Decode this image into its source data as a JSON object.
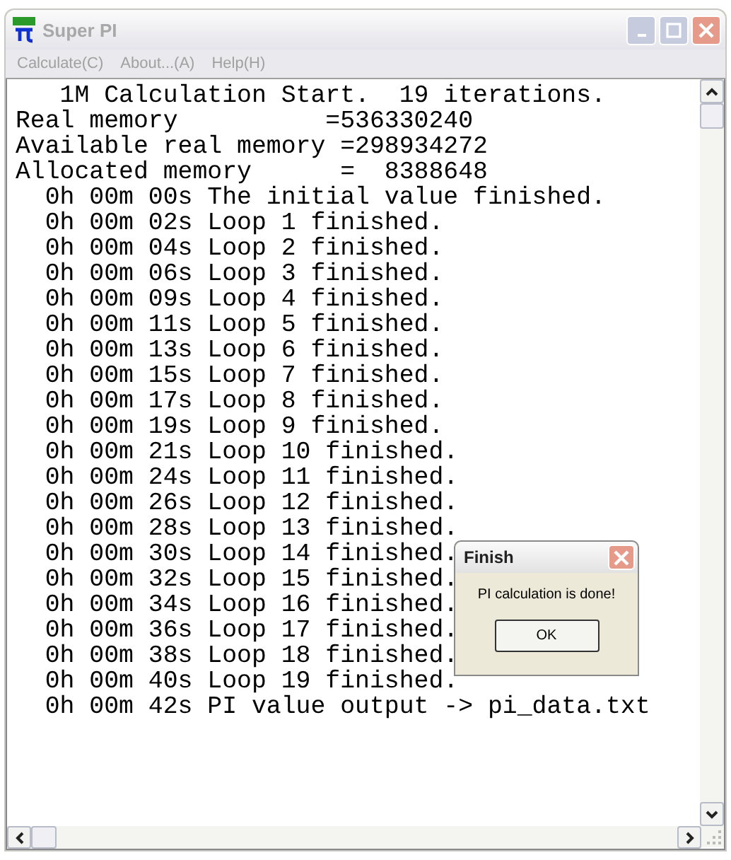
{
  "window": {
    "title": "Super PI"
  },
  "menu": [
    "Calculate(C)",
    "About...(A)",
    "Help(H)"
  ],
  "lines": [
    "   1M Calculation Start.  19 iterations.",
    "Real memory          =536330240",
    "Available real memory =298934272",
    "Allocated memory      =  8388648",
    "  0h 00m 00s The initial value finished.",
    "  0h 00m 02s Loop 1 finished.",
    "  0h 00m 04s Loop 2 finished.",
    "  0h 00m 06s Loop 3 finished.",
    "  0h 00m 09s Loop 4 finished.",
    "  0h 00m 11s Loop 5 finished.",
    "  0h 00m 13s Loop 6 finished.",
    "  0h 00m 15s Loop 7 finished.",
    "  0h 00m 17s Loop 8 finished.",
    "  0h 00m 19s Loop 9 finished.",
    "  0h 00m 21s Loop 10 finished.",
    "  0h 00m 24s Loop 11 finished.",
    "  0h 00m 26s Loop 12 finished.",
    "  0h 00m 28s Loop 13 finished.",
    "  0h 00m 30s Loop 14 finished.",
    "  0h 00m 32s Loop 15 finished.",
    "  0h 00m 34s Loop 16 finished.",
    "  0h 00m 36s Loop 17 finished.",
    "  0h 00m 38s Loop 18 finished.",
    "  0h 00m 40s Loop 19 finished.",
    "  0h 00m 42s PI value output -> pi_data.txt"
  ],
  "dialog": {
    "title": "Finish",
    "message": "PI calculation is done!",
    "button": "OK"
  }
}
